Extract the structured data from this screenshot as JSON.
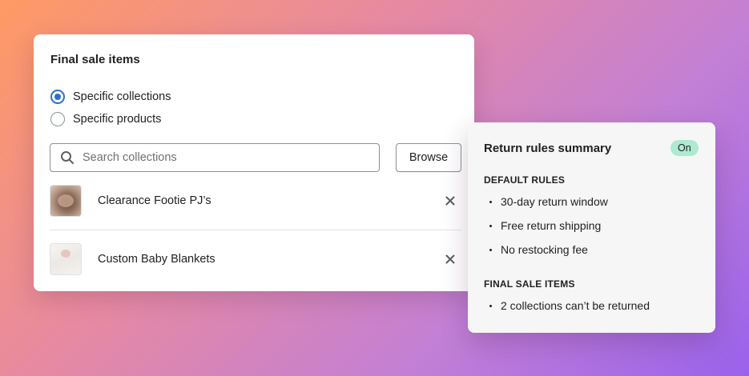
{
  "final_sale_card": {
    "title": "Final sale items",
    "radio_options": [
      {
        "label": "Specific collections",
        "checked": true
      },
      {
        "label": "Specific products",
        "checked": false
      }
    ],
    "search": {
      "placeholder": "Search collections",
      "value": "",
      "icon": "search-icon"
    },
    "browse_label": "Browse",
    "items": [
      {
        "label": "Clearance Footie PJ’s",
        "thumbnail": "baby-in-pajamas-photo",
        "remove_icon": "close-icon"
      },
      {
        "label": "Custom Baby Blankets",
        "thumbnail": "baby-blanket-photo",
        "remove_icon": "close-icon"
      }
    ]
  },
  "summary_card": {
    "title": "Return rules summary",
    "status_badge": "On",
    "default_rules": {
      "heading": "DEFAULT RULES",
      "items": [
        "30-day return window",
        "Free return shipping",
        "No restocking fee"
      ]
    },
    "final_sale": {
      "heading": "FINAL SALE ITEMS",
      "items": [
        "2 collections can’t be returned"
      ]
    }
  },
  "colors": {
    "accent": "#2c6ecb",
    "badge_on": "#aee9d1",
    "background_gradient": [
      "#ff9a63",
      "#e88aa0",
      "#c27fd6",
      "#9a62ec"
    ]
  }
}
